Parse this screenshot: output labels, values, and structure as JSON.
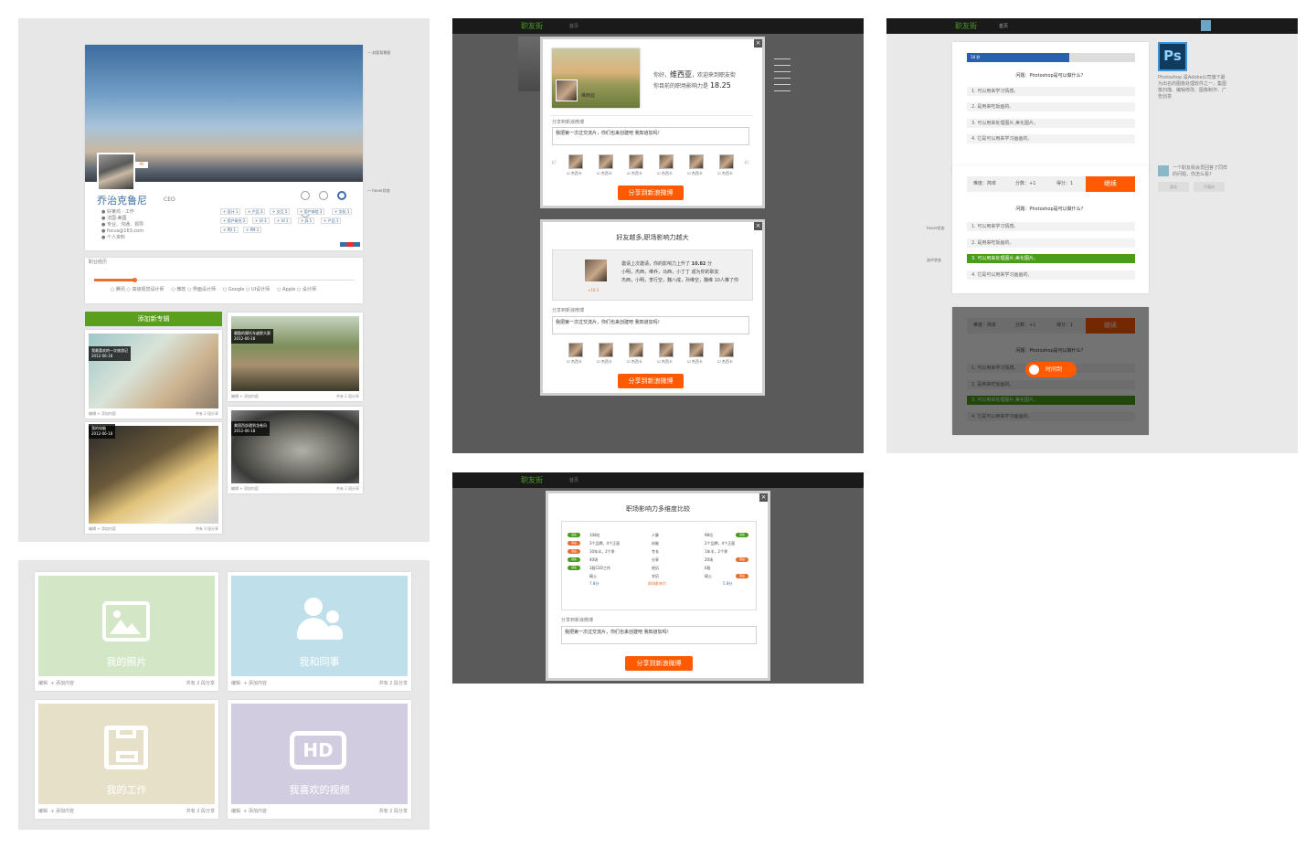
{
  "profile": {
    "name": "乔治克鲁尼",
    "title": "CEO",
    "add_album": "添加新专辑",
    "albums": [
      {
        "caption": "我最喜欢的一次旅游记",
        "date": "2012-06-18",
        "edit": "编辑",
        "add": "添加内容",
        "count": "共有 2 段分享"
      },
      {
        "caption": "最酷的摩托车越野大赛",
        "date": "2012-06-18",
        "edit": "编辑",
        "add": "添加内容",
        "count": "共有 2 段分享"
      },
      {
        "caption": "我的电脑",
        "date": "2012-06-18",
        "edit": "编辑",
        "add": "添加内容",
        "count": "共有 3 段分享"
      },
      {
        "caption": "美国西部遇到龙卷风",
        "date": "2012-06-18",
        "edit": "编辑",
        "add": "添加内容",
        "count": "共有 2 段分享"
      }
    ]
  },
  "collections": {
    "tiles": [
      {
        "label": "我的照片",
        "edit": "编辑",
        "add": "添加内容",
        "count": "共有 2 段分享",
        "color": "#d3e6c6"
      },
      {
        "label": "我和同事",
        "edit": "编辑",
        "add": "添加内容",
        "count": "共有 2 段分享",
        "color": "#bfe0ea"
      },
      {
        "label": "我的工作",
        "edit": "编辑",
        "add": "添加内容",
        "count": "共有 2 段分享",
        "color": "#e6e0c8"
      },
      {
        "label": "我喜欢的视频",
        "edit": "编辑",
        "add": "添加内容",
        "count": "共有 2 段分享",
        "color": "#d2cce0"
      }
    ]
  },
  "nav": {
    "logo": "职友街",
    "home": "首页"
  },
  "welcome_modal": {
    "greeting": "你好，",
    "username": "维西亚",
    "welcome": "，欢迎来到职友街",
    "influence_text": "你目前的职场影响力是",
    "influence_value": "18.25",
    "card_name": "维西亚",
    "share_label": "分享到新浪微博",
    "share_button": "分享到新浪微博",
    "close": "×",
    "friends_label": "推荐关注"
  },
  "friends_modal": {
    "title": "好友越多,职场影响力越大",
    "influence_value": "10.82",
    "share_button": "分享到新浪微博",
    "close": "×"
  },
  "compare_modal": {
    "title": "职场影响力多维度比较",
    "share_button": "分享到新浪微博",
    "close": "×",
    "rows": [
      {
        "badge": "领先",
        "color": "#4a9d1a",
        "left": "108位",
        "mid": "人脉",
        "right": "98位",
        "rbadge": "领先",
        "rcolor": "#4a9d1a"
      },
      {
        "badge": "落后",
        "color": "#e8702a",
        "left": "3个品牌，4个正面",
        "mid": "技能",
        "right": "2个品牌，4个正面",
        "rbadge": "",
        "rcolor": ""
      },
      {
        "badge": "落后",
        "color": "#e8702a",
        "left": "10年半，2个季",
        "mid": "专长",
        "right": "1年半，2个季",
        "rbadge": "",
        "rcolor": ""
      },
      {
        "badge": "领先",
        "color": "#4a9d1a",
        "left": "40场",
        "mid": "分享",
        "right": "20场",
        "rbadge": "落后",
        "rcolor": "#e8702a"
      },
      {
        "badge": "领先",
        "color": "#4a9d1a",
        "left": "3段CEO工作",
        "mid": "经历",
        "right": "0段",
        "rbadge": "",
        "rcolor": ""
      },
      {
        "badge": "",
        "color": "",
        "left": "硕士",
        "mid": "学历",
        "right": "硕士",
        "rbadge": "落后",
        "rcolor": "#e8702a"
      }
    ],
    "footer_left": "7.8分",
    "footer_mid": "职场影响力",
    "footer_right": "5.8分"
  },
  "quiz": {
    "timer": "18 秒",
    "question": "问题：Photoshop是可以做什么？",
    "options": [
      "1. 可以用来学习情感。",
      "2. 是用来吃饭画的。",
      "3. 可以用来处理图片,美化图片。",
      "4. 它是可以用来学习画画的。"
    ],
    "difficulty": "难度：简单",
    "score_gain": "分数：+1",
    "score": "得分：1",
    "continue": "继续",
    "time_up": "时间到",
    "ps_desc": "Photoshop 是Adobe公司旗下最为出名的图像处理软件之一，集图像扫描、编辑修改、图像制作、广告创意",
    "hover_label": "hover状态",
    "selected_label": "选中状态",
    "like": "喜欢",
    "unlike": "不喜欢"
  },
  "share_placeholder": "我把第一次过交流片，你们也来创建吧 我知道加吗！"
}
